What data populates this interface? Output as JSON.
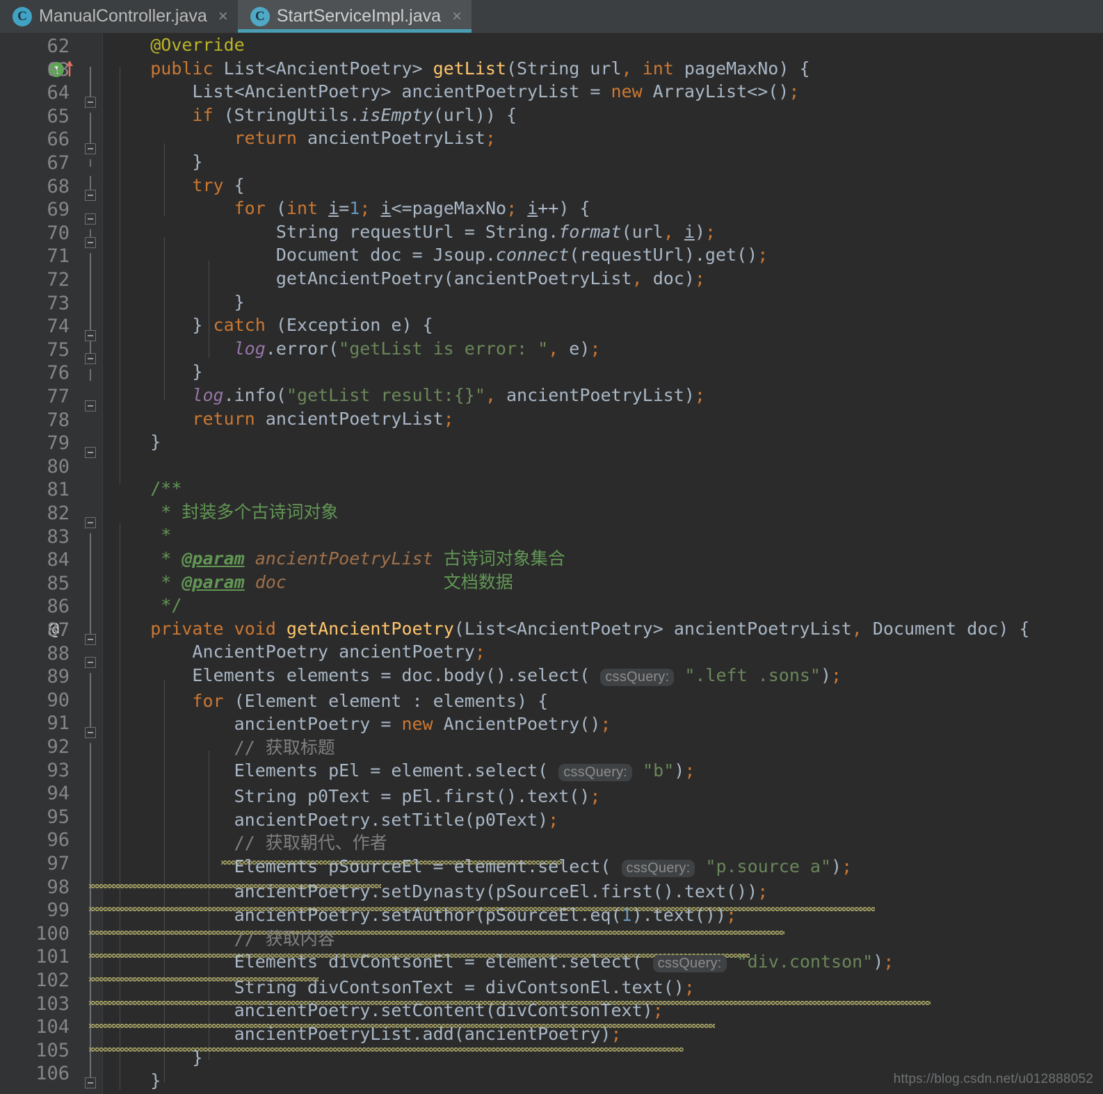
{
  "window": {
    "title": "StartServiceImpl.java - IntelliJ IDEA Editor",
    "background_color": "#2b2b2b",
    "gutter_color": "#313335"
  },
  "tabbar": {
    "tabs": [
      {
        "label": "ManualController.java",
        "icon": "java-class-icon",
        "icon_letter": "C",
        "close_glyph": "×",
        "active": false
      },
      {
        "label": "StartServiceImpl.java",
        "icon": "java-class-icon",
        "icon_letter": "C",
        "close_glyph": "×",
        "active": true
      }
    ],
    "active_underline_color": "#4a9fb5"
  },
  "editor": {
    "first_line": 62,
    "last_line": 106,
    "gutter_markers": {
      "line_63": "implements-method-marker",
      "line_87": "@"
    },
    "watermark": "https://blog.csdn.net/u012888052",
    "lines": [
      {
        "n": 62,
        "text": "    @Override"
      },
      {
        "n": 63,
        "text": "    public List<AncientPoetry> getList(String url, int pageMaxNo) {"
      },
      {
        "n": 64,
        "text": "        List<AncientPoetry> ancientPoetryList = new ArrayList<>();"
      },
      {
        "n": 65,
        "text": "        if (StringUtils.isEmpty(url)) {"
      },
      {
        "n": 66,
        "text": "            return ancientPoetryList;"
      },
      {
        "n": 67,
        "text": "        }"
      },
      {
        "n": 68,
        "text": "        try {"
      },
      {
        "n": 69,
        "text": "            for (int i=1; i<=pageMaxNo; i++) {"
      },
      {
        "n": 70,
        "text": "                String requestUrl = String.format(url, i);"
      },
      {
        "n": 71,
        "text": "                Document doc = Jsoup.connect(requestUrl).get();"
      },
      {
        "n": 72,
        "text": "                getAncientPoetry(ancientPoetryList, doc);"
      },
      {
        "n": 73,
        "text": "            }"
      },
      {
        "n": 74,
        "text": "        } catch (Exception e) {"
      },
      {
        "n": 75,
        "text": "            log.error(\"getList is error: \", e);"
      },
      {
        "n": 76,
        "text": "        }"
      },
      {
        "n": 77,
        "text": "        log.info(\"getList result:{}\", ancientPoetryList);"
      },
      {
        "n": 78,
        "text": "        return ancientPoetryList;"
      },
      {
        "n": 79,
        "text": "    }"
      },
      {
        "n": 80,
        "text": ""
      },
      {
        "n": 81,
        "text": "    /**"
      },
      {
        "n": 82,
        "text": "     * 封装多个古诗词对象"
      },
      {
        "n": 83,
        "text": "     *"
      },
      {
        "n": 84,
        "text": "     * @param ancientPoetryList 古诗词对象集合"
      },
      {
        "n": 85,
        "text": "     * @param doc                文档数据"
      },
      {
        "n": 86,
        "text": "     */"
      },
      {
        "n": 87,
        "text": "    private void getAncientPoetry(List<AncientPoetry> ancientPoetryList, Document doc) {"
      },
      {
        "n": 88,
        "text": "        AncientPoetry ancientPoetry;"
      },
      {
        "n": 89,
        "text": "        Elements elements = doc.body().select( cssQuery: \".left .sons\");"
      },
      {
        "n": 90,
        "text": "        for (Element element : elements) {"
      },
      {
        "n": 91,
        "text": "            ancientPoetry = new AncientPoetry();"
      },
      {
        "n": 92,
        "text": "            // 获取标题"
      },
      {
        "n": 93,
        "text": "            Elements pEl = element.select( cssQuery: \"b\");"
      },
      {
        "n": 94,
        "text": "            String p0Text = pEl.first().text();"
      },
      {
        "n": 95,
        "text": "            ancientPoetry.setTitle(p0Text);"
      },
      {
        "n": 96,
        "text": "            // 获取朝代、作者"
      },
      {
        "n": 97,
        "text": "            Elements pSourceEl = element.select( cssQuery: \"p.source a\");"
      },
      {
        "n": 98,
        "text": "            ancientPoetry.setDynasty(pSourceEl.first().text());"
      },
      {
        "n": 99,
        "text": "            ancientPoetry.setAuthor(pSourceEl.eq(1).text());"
      },
      {
        "n": 100,
        "text": "            // 获取内容"
      },
      {
        "n": 101,
        "text": "            Elements divContsonEl = element.select( cssQuery: \"div.contson\");"
      },
      {
        "n": 102,
        "text": "            String divContsonText = divContsonEl.text();"
      },
      {
        "n": 103,
        "text": "            ancientPoetry.setContent(divContsonText);"
      },
      {
        "n": 104,
        "text": "            ancientPoetryList.add(ancientPoetry);"
      },
      {
        "n": 105,
        "text": "        }"
      },
      {
        "n": 106,
        "text": "    }"
      }
    ],
    "inlay_hints": [
      {
        "line": 89,
        "label": "cssQuery:"
      },
      {
        "line": 93,
        "label": "cssQuery:"
      },
      {
        "line": 97,
        "label": "cssQuery:"
      },
      {
        "line": 101,
        "label": "cssQuery:"
      }
    ],
    "weak_warning_lines": [
      95,
      96,
      97,
      98,
      99,
      100,
      101,
      102,
      103
    ],
    "colors": {
      "keyword": "#cc7832",
      "annotation": "#bbb529",
      "string": "#6a8759",
      "number": "#6897bb",
      "comment": "#808080",
      "javadoc": "#629755",
      "javadoc_param": "#a1714b",
      "static_field": "#9876aa",
      "method_decl": "#ffc66d",
      "default_text": "#a9b7c6",
      "weak_warning": "#a9a567"
    }
  }
}
